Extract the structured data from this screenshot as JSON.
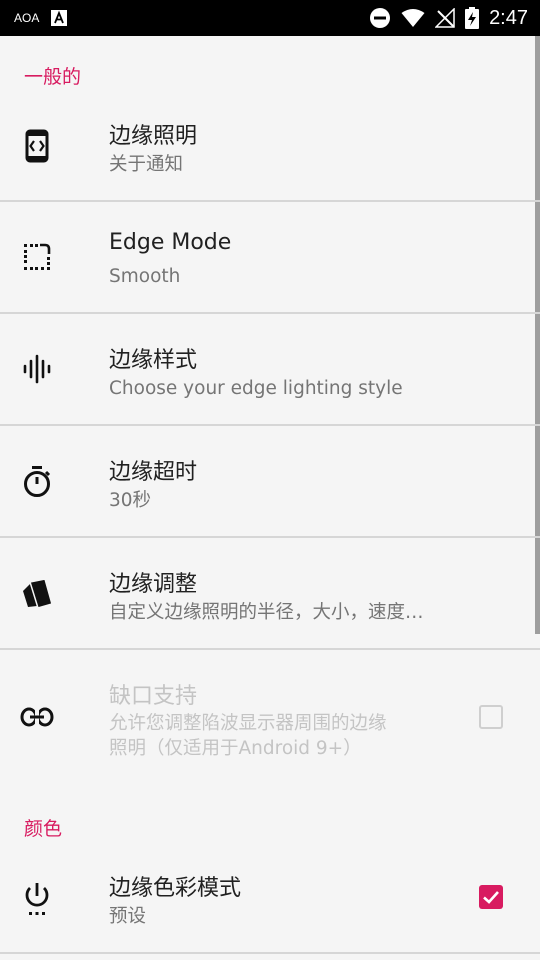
{
  "status_bar": {
    "carrier": "AOA",
    "time": "2:47",
    "icons": [
      "notification-a-icon",
      "dnd-icon",
      "wifi-icon",
      "no-signal-icon",
      "battery-charging-icon"
    ]
  },
  "sections": [
    {
      "header": "一般的",
      "items": [
        {
          "title": "边缘照明",
          "summary": "关于通知",
          "icon": "edge-screen-icon",
          "enabled": true
        },
        {
          "title": "Edge Mode",
          "summary": "Smooth",
          "icon": "dotted-corner-icon",
          "enabled": true
        },
        {
          "title": "边缘样式",
          "summary": "Choose your edge lighting style",
          "icon": "waveform-icon",
          "enabled": true
        },
        {
          "title": "边缘超时",
          "summary": "30秒",
          "icon": "timer-icon",
          "enabled": true
        },
        {
          "title": "边缘调整",
          "summary": "自定义边缘照明的半径，大小，速度…",
          "icon": "cards-icon",
          "enabled": true
        },
        {
          "title": "缺口支持",
          "summary_lines": [
            "允许您调整陷波显示器周围的边缘",
            "照明（仅适用于Android 9+）"
          ],
          "icon": "link-icon",
          "enabled": false,
          "checked": false
        }
      ]
    },
    {
      "header": "颜色",
      "items": [
        {
          "title": "边缘色彩模式",
          "summary": "预设",
          "icon": "power-dots-icon",
          "enabled": true,
          "checked": true
        }
      ]
    }
  ],
  "colors": {
    "accent": "#d81b60",
    "status_bar": "#000000",
    "background": "#f5f5f5"
  }
}
